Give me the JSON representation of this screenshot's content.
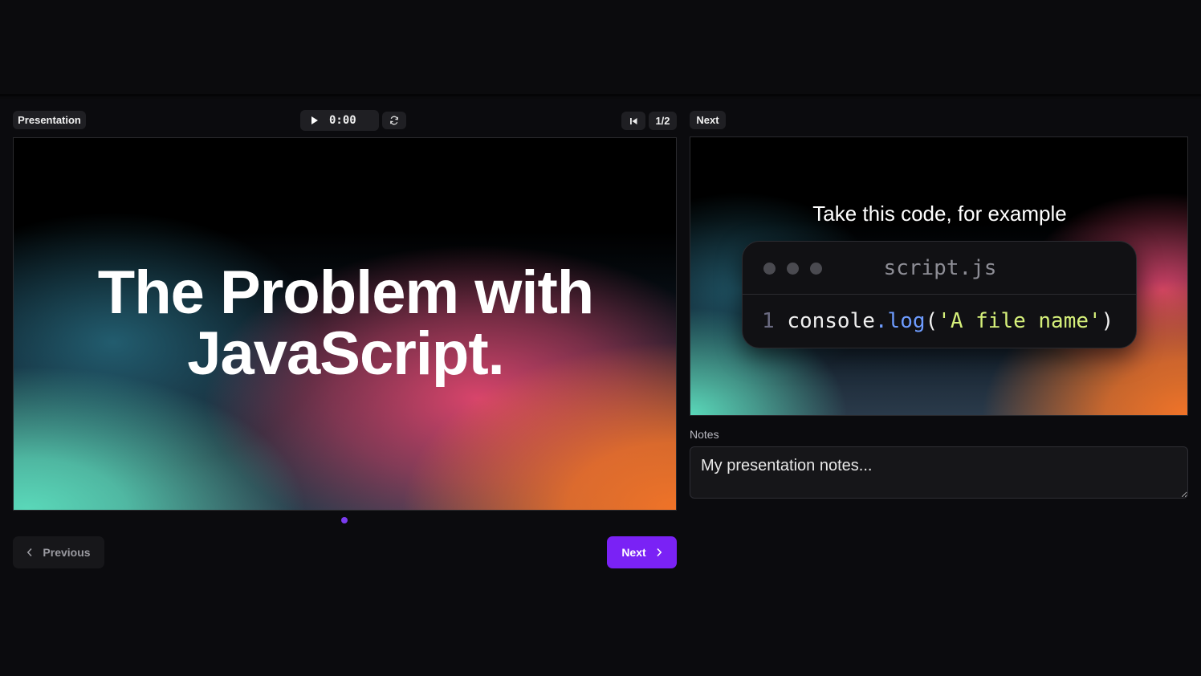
{
  "toolbar": {
    "presentation_label": "Presentation",
    "timer": "0:00",
    "slide_counter": "1/2",
    "next_label": "Next"
  },
  "current_slide": {
    "title_line1": "The Problem with",
    "title_line2": "JavaScript."
  },
  "next_slide": {
    "heading": "Take this code, for example",
    "code_file": "script.js",
    "code_line_number": "1",
    "code_object": "console",
    "code_dot": ".",
    "code_method": "log",
    "code_open": "(",
    "code_string": "'A file name'",
    "code_close": ")"
  },
  "navigation": {
    "previous_label": "Previous",
    "next_label": "Next"
  },
  "notes": {
    "label": "Notes",
    "placeholder": "My presentation notes..."
  },
  "colors": {
    "accent": "#7a22f5",
    "background": "#0a0a0c"
  }
}
